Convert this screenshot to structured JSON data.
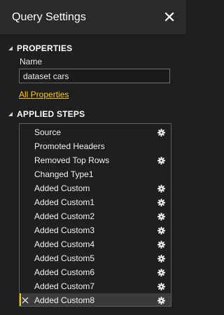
{
  "header": {
    "title": "Query Settings",
    "close_icon": "close-icon"
  },
  "properties": {
    "section_label": "PROPERTIES",
    "name_label": "Name",
    "name_value": "dataset cars",
    "all_properties_link": "All Properties"
  },
  "applied_steps": {
    "section_label": "APPLIED STEPS",
    "steps": [
      {
        "label": "Source",
        "has_gear": true
      },
      {
        "label": "Promoted Headers",
        "has_gear": false
      },
      {
        "label": "Removed Top Rows",
        "has_gear": true
      },
      {
        "label": "Changed Type1",
        "has_gear": false
      },
      {
        "label": "Added Custom",
        "has_gear": true
      },
      {
        "label": "Added Custom1",
        "has_gear": true
      },
      {
        "label": "Added Custom2",
        "has_gear": true
      },
      {
        "label": "Added Custom3",
        "has_gear": true
      },
      {
        "label": "Added Custom4",
        "has_gear": true
      },
      {
        "label": "Added Custom5",
        "has_gear": true
      },
      {
        "label": "Added Custom6",
        "has_gear": true
      },
      {
        "label": "Added Custom7",
        "has_gear": true
      },
      {
        "label": "Added Custom8",
        "has_gear": true,
        "selected": true
      }
    ]
  },
  "colors": {
    "accent": "#f2c811",
    "background": "#1f1f1f",
    "header_background": "#2a2a2a",
    "selected_row": "#3b3b3b"
  }
}
